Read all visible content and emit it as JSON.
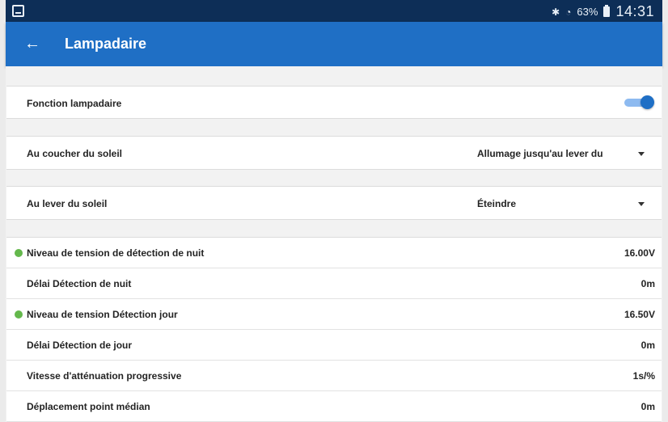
{
  "statusbar": {
    "battery_percent": "63%",
    "time": "14:31"
  },
  "appbar": {
    "title": "Lampadaire"
  },
  "settings": {
    "street_light": {
      "label": "Fonction lampadaire",
      "enabled": true
    },
    "sunset": {
      "label": "Au coucher du soleil",
      "value": "Allumage jusqu'au lever du"
    },
    "sunrise": {
      "label": "Au lever du soleil",
      "value": "Éteindre"
    }
  },
  "params": [
    {
      "label": "Niveau de tension de détection de nuit",
      "value": "16.00V",
      "indicator": true
    },
    {
      "label": "Délai Détection de nuit",
      "value": "0m",
      "indicator": false
    },
    {
      "label": "Niveau de tension Détection jour",
      "value": "16.50V",
      "indicator": true
    },
    {
      "label": "Délai Détection de jour",
      "value": "0m",
      "indicator": false
    },
    {
      "label": "Vitesse d'atténuation progressive",
      "value": "1s/%",
      "indicator": false
    },
    {
      "label": "Déplacement point médian",
      "value": "0m",
      "indicator": false
    }
  ],
  "colors": {
    "statusbar": "#0d2e57",
    "appbar": "#1f6fc5",
    "indicator": "#64b84c"
  }
}
